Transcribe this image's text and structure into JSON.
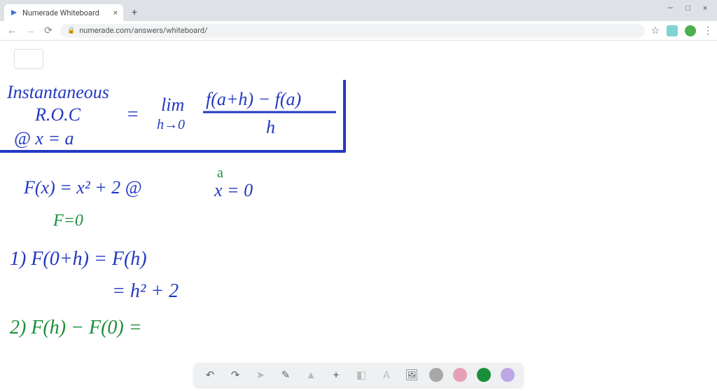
{
  "window": {
    "minimize": "—",
    "maximize": "□",
    "close": "×"
  },
  "tab": {
    "title": "Numerade Whiteboard"
  },
  "url": "numerade.com/answers/whiteboard/",
  "handwriting": {
    "line1a": "Instantaneous",
    "line1b": "R.O.C",
    "line1c": "@ x = a",
    "lim": "lim",
    "hto0": "h→0",
    "frac_top": "f(a+h) − f(a)",
    "frac_bot": "h",
    "fxdef": "F(x) = x² + 2    @",
    "a_label": "a",
    "x0": "x = 0",
    "feq0": "F=0",
    "step1": "1) F(0+h)  =  F(h)",
    "step1b": "= h² + 2",
    "step2": "2) F(h) − F(0)  ="
  },
  "colors": {
    "blue": "#2338c2",
    "green": "#1a8f3a",
    "gray": "#a8a8a8",
    "pink": "#e6a0b6",
    "purple": "#bda7e5"
  },
  "toolbar": {
    "undo": "↶",
    "redo": "↷",
    "pointer": "➤",
    "pen": "✎",
    "shapes": "▲",
    "plus": "+",
    "eraser": "◧",
    "text": "A",
    "image": "🖼"
  }
}
